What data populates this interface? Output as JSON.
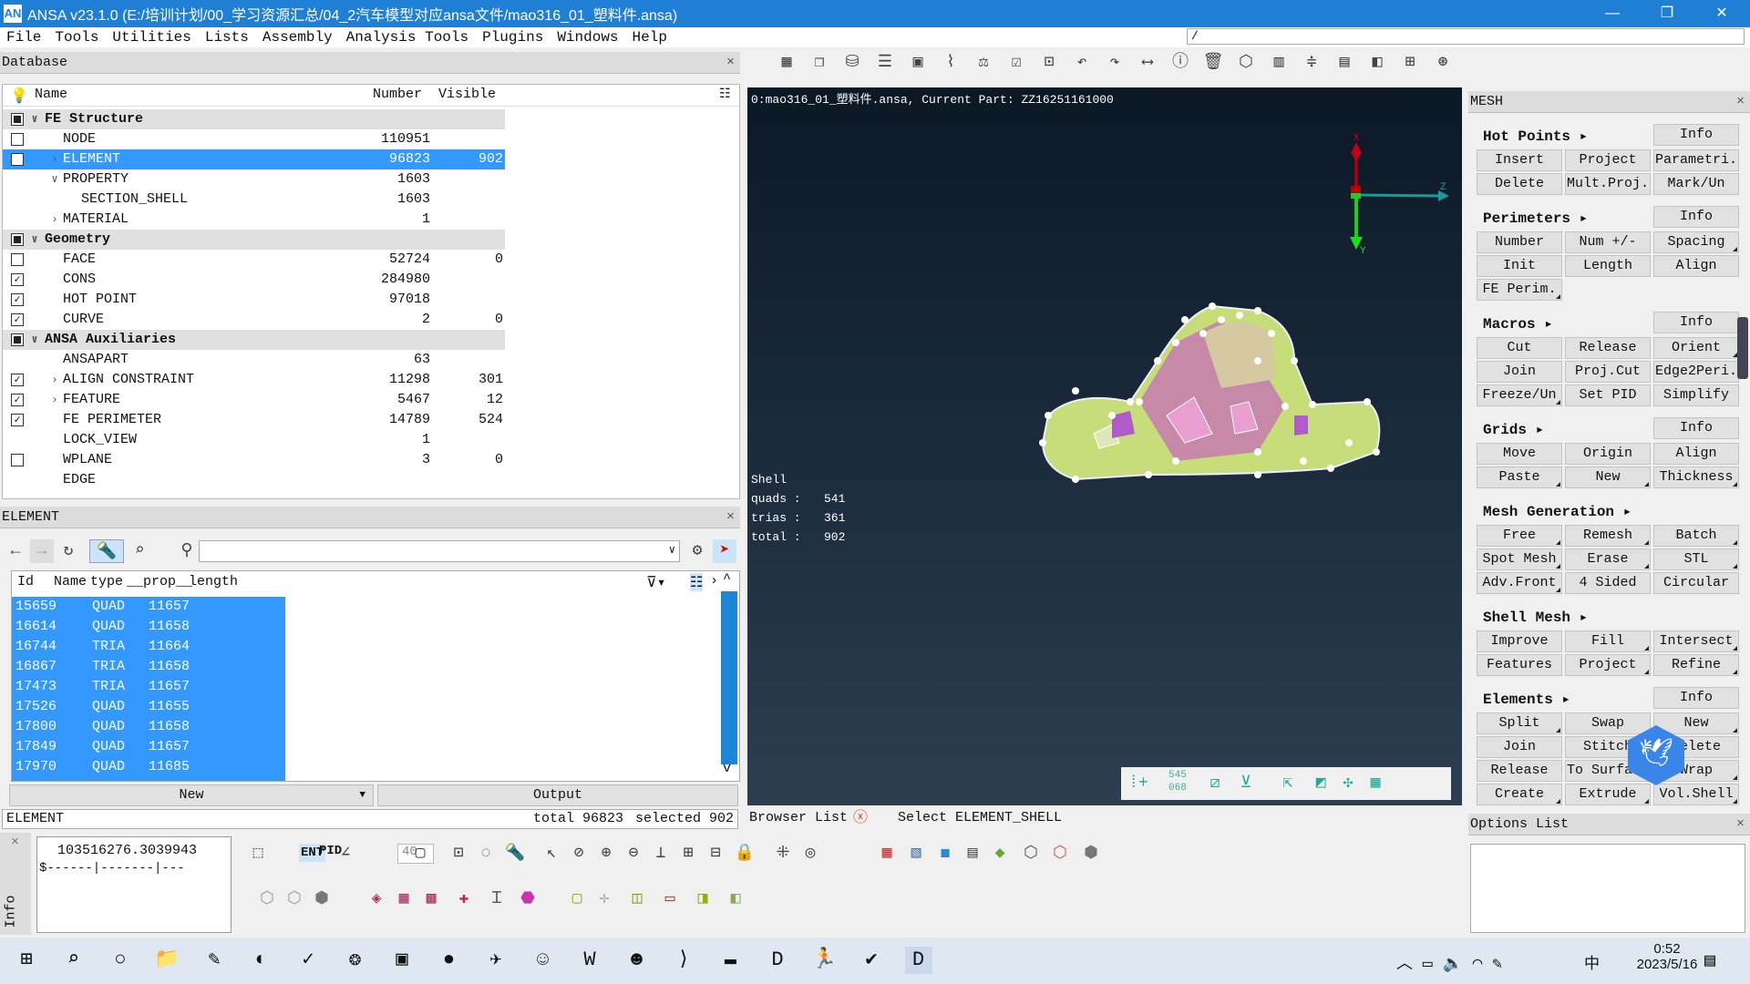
{
  "window": {
    "title": "ANSA v23.1.0 (E:/培训计划/00_学习资源汇总/04_2汽车模型对应ansa文件/mao316_01_塑料件.ansa)",
    "logo": "AN",
    "minimize": "—",
    "maximize": "❐",
    "close": "✕"
  },
  "menu": [
    "File",
    "Tools",
    "Utilities",
    "Lists",
    "Assembly",
    "Analysis Tools",
    "Plugins",
    "Windows",
    "Help"
  ],
  "search": {
    "value": "/"
  },
  "database": {
    "title": "Database",
    "close": "×",
    "columns": {
      "name": "Name",
      "number": "Number",
      "visible": "Visible"
    },
    "rows": [
      {
        "label": "FE Structure",
        "group": true,
        "cb": "partial",
        "exp": "down",
        "level": 0
      },
      {
        "label": "NODE",
        "number": "110951",
        "cb": "unchecked",
        "level": 1
      },
      {
        "label": "ELEMENT",
        "number": "96823",
        "visible": "902",
        "cb": "checked",
        "exp": "right",
        "level": 1,
        "selected": true
      },
      {
        "label": "PROPERTY",
        "number": "1603",
        "exp": "down",
        "level": 1
      },
      {
        "label": "SECTION_SHELL",
        "number": "1603",
        "level": 2
      },
      {
        "label": "MATERIAL",
        "number": "1",
        "exp": "right",
        "level": 1
      },
      {
        "label": "Geometry",
        "group": true,
        "cb": "partial",
        "exp": "down",
        "level": 0
      },
      {
        "label": "FACE",
        "number": "52724",
        "visible": "0",
        "cb": "unchecked",
        "level": 1
      },
      {
        "label": "CONS",
        "number": "284980",
        "cb": "checked",
        "level": 1
      },
      {
        "label": "HOT POINT",
        "number": "97018",
        "cb": "checked",
        "level": 1
      },
      {
        "label": "CURVE",
        "number": "2",
        "visible": "0",
        "cb": "checked",
        "level": 1
      },
      {
        "label": "ANSA Auxiliaries",
        "group": true,
        "cb": "partial",
        "exp": "down",
        "level": 0
      },
      {
        "label": "ANSAPART",
        "number": "63",
        "level": 1
      },
      {
        "label": "ALIGN CONSTRAINT",
        "number": "11298",
        "visible": "301",
        "cb": "checked",
        "exp": "right",
        "level": 1
      },
      {
        "label": "FEATURE",
        "number": "5467",
        "visible": "12",
        "cb": "checked",
        "exp": "right",
        "level": 1
      },
      {
        "label": "FE PERIMETER",
        "number": "14789",
        "visible": "524",
        "cb": "checked",
        "level": 1
      },
      {
        "label": "LOCK_VIEW",
        "number": "1",
        "level": 1
      },
      {
        "label": "WPLANE",
        "number": "3",
        "visible": "0",
        "cb": "unchecked",
        "level": 1
      },
      {
        "label": "EDGE",
        "level": 1
      }
    ]
  },
  "element_list": {
    "title": "ELEMENT",
    "close": "×",
    "columns": [
      "Id",
      "Name",
      "type",
      "__prop__",
      "length"
    ],
    "rows": [
      [
        "15659",
        "",
        "QUAD",
        "11657"
      ],
      [
        "16614",
        "",
        "QUAD",
        "11658"
      ],
      [
        "16744",
        "",
        "TRIA",
        "11664"
      ],
      [
        "16867",
        "",
        "TRIA",
        "11658"
      ],
      [
        "17473",
        "",
        "TRIA",
        "11657"
      ],
      [
        "17526",
        "",
        "QUAD",
        "11655"
      ],
      [
        "17800",
        "",
        "QUAD",
        "11658"
      ],
      [
        "17849",
        "",
        "QUAD",
        "11657"
      ],
      [
        "17970",
        "",
        "QUAD",
        "11685"
      ]
    ],
    "new_label": "New",
    "output_label": "Output",
    "status": {
      "name": "ELEMENT",
      "total": "total 96823",
      "selected": "selected 902"
    }
  },
  "info": {
    "tab": "Info",
    "value": "103516276.3039943",
    "line": "$------|-------|---",
    "angle": "40",
    "ent": "ENT",
    "pid": "PID"
  },
  "viewport": {
    "header": "0:mao316_01_塑料件.ansa,  Current Part: ZZ16251161000",
    "stats": {
      "title": "Shell",
      "quads_label": "quads :",
      "quads": "541",
      "trias_label": "trias :",
      "trias": "361",
      "total_label": "total :",
      "total": "902"
    },
    "axes": {
      "x": "X",
      "y": "Y",
      "z": "Z"
    },
    "counter": "545\n068"
  },
  "browser": {
    "label": "Browser List",
    "message": "Select ELEMENT_SHELL"
  },
  "mesh": {
    "title": "MESH",
    "close": "×",
    "sections": [
      {
        "title": "Hot Points ▸",
        "info": "Info",
        "rows": [
          [
            "Insert",
            "Project",
            "Parametri."
          ],
          [
            "Delete",
            "Mult.Proj.",
            "Mark/Un"
          ]
        ]
      },
      {
        "title": "Perimeters ▸",
        "info": "Info",
        "rows": [
          [
            "Number",
            "Num +/-",
            "Spacing"
          ],
          [
            "Init",
            "Length",
            "Align"
          ],
          [
            "FE Perim."
          ]
        ]
      },
      {
        "title": "Macros ▸",
        "info": "Info",
        "rows": [
          [
            "Cut",
            "Release",
            "Orient"
          ],
          [
            "Join",
            "Proj.Cut",
            "Edge2Peri."
          ],
          [
            "Freeze/Un",
            "Set PID",
            "Simplify"
          ]
        ]
      },
      {
        "title": "Grids ▸",
        "info": "Info",
        "rows": [
          [
            "Move",
            "Origin",
            "Align"
          ],
          [
            "Paste",
            "New",
            "Thickness"
          ]
        ]
      },
      {
        "title": "Mesh Generation ▸",
        "rows": [
          [
            "Free",
            "Remesh",
            "Batch"
          ],
          [
            "Spot Mesh",
            "Erase",
            "STL"
          ],
          [
            "Adv.Front",
            "4 Sided",
            "Circular"
          ]
        ]
      },
      {
        "title": "Shell Mesh ▸",
        "rows": [
          [
            "Improve",
            "Fill",
            "Intersect"
          ],
          [
            "Features",
            "Project",
            "Refine"
          ]
        ]
      },
      {
        "title": "Elements ▸",
        "info": "Info",
        "rows": [
          [
            "Split",
            "Swap",
            "New"
          ],
          [
            "Join",
            "Stitch",
            "Delete"
          ],
          [
            "Release",
            "To Surface",
            "Wrap"
          ],
          [
            "Create",
            "Extrude",
            "Vol.Shell"
          ]
        ]
      }
    ]
  },
  "options": {
    "title": "Options List",
    "close": "×"
  },
  "taskbar": {
    "time": "0:52",
    "date": "2023/5/16",
    "ime": "中",
    "icons": [
      "windows-start-icon",
      "search-icon",
      "task-view-icon",
      "file-explorer-icon",
      "notepad-icon",
      "edge-browser-icon",
      "app-check-icon",
      "app-blue-icon",
      "remote-desktop-icon",
      "record-icon",
      "feishu-icon",
      "wechat-icon",
      "wps-icon",
      "avatar-app-icon",
      "vscode-icon",
      "terminal-icon",
      "ansa-d-icon",
      "runner-app-icon",
      "norton-icon",
      "ansa-active-icon"
    ]
  },
  "colors": {
    "accent": "#1f7fd4",
    "selection": "#3399ff",
    "viewport_top": "#0b1826",
    "viewport_bottom": "#2c3e50"
  }
}
